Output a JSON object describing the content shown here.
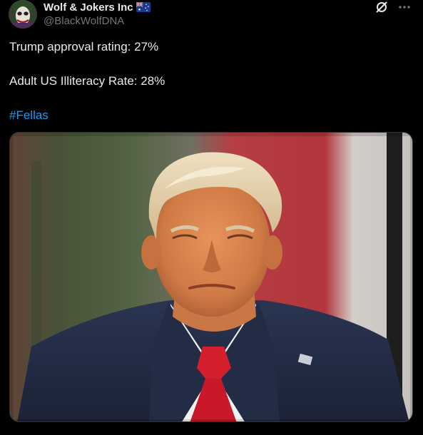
{
  "author": {
    "display_name": "Wolf & Jokers Inc",
    "handle": "@BlackWolfDNA",
    "avatar_icon": "joker-avatar",
    "badge_icon": "australian-flag-icon"
  },
  "top_actions": {
    "grok_icon": "grok-icon",
    "more_icon": "more-options-icon"
  },
  "tweet": {
    "line1": "Trump approval rating: 27%",
    "line2": "Adult US Illiteracy Rate: 28%",
    "hashtag": "#Fellas"
  },
  "media": {
    "kind": "photo",
    "subject": "portrait-photo"
  },
  "colors": {
    "background": "#000000",
    "text_primary": "#e7e9ea",
    "text_secondary": "#71767b",
    "link": "#1d9bf0"
  }
}
